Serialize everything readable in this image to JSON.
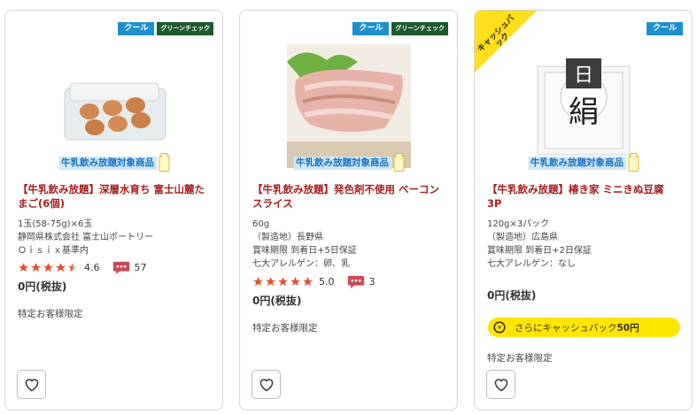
{
  "products": [
    {
      "badges": [
        "クール",
        "グリーンチェック"
      ],
      "milk_banner": "牛乳飲み放題対象商品",
      "title": "【牛乳飲み放題】深層水育ち 富士山麓たまご(6個)",
      "info_lines": [
        "1玉(58-75g)×6玉",
        "静岡県株式会社 富士山ポートリー",
        "Ｏｉｓｉｘ基準内"
      ],
      "rating": "4.6",
      "stars": 4.5,
      "comments": "57",
      "price": "0円(税抜)",
      "limited": "特定お客様限定",
      "image_icon": "egg-carton-image"
    },
    {
      "badges": [
        "クール",
        "グリーンチェック"
      ],
      "milk_banner": "牛乳飲み放題対象商品",
      "title": "【牛乳飲み放題】発色剤不使用 ベーコンスライス",
      "info_lines": [
        "60g",
        "（製造地）長野県",
        "賞味期限 到着日+5日保証",
        "七大アレルゲン：卵、乳"
      ],
      "rating": "5.0",
      "stars": 5,
      "comments": "3",
      "price": "0円(税抜)",
      "limited": "特定お客様限定",
      "image_icon": "bacon-image"
    },
    {
      "badges": [
        "クール"
      ],
      "corner": "キャッシュバック",
      "milk_banner": "牛乳飲み放題対象商品",
      "title": "【牛乳飲み放題】椿き家 ミニきぬ豆腐　3P",
      "info_lines": [
        "120g×3パック",
        "（製造地）広島県",
        "賞味期限 到着日+2日保証",
        "七大アレルゲン：なし"
      ],
      "price": "0円(税抜)",
      "cashback": "さらにキャッシュバック",
      "cashback_amount": "50円",
      "limited": "特定お客様限定",
      "image_icon": "tofu-pack-image"
    }
  ],
  "colors": {
    "title": "#a51d1d",
    "star": "#e8502a",
    "cool_badge": "#1e8fcc",
    "green_badge": "#1e5a2c",
    "cashback": "#ffe600"
  }
}
